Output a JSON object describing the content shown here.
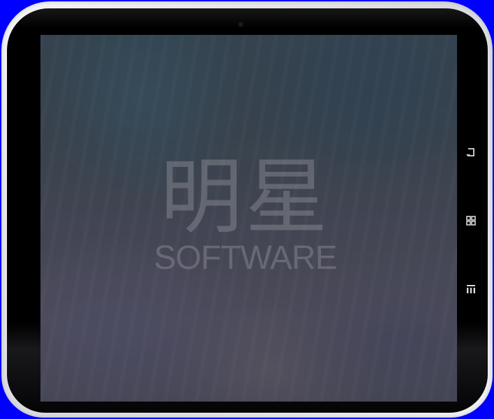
{
  "brand": {
    "cjk": "明星",
    "latin": "SOFTWARE"
  },
  "icons": {
    "back": "back-icon",
    "home": "home-icon",
    "menu": "menu-icon"
  },
  "colors": {
    "background": "#0000ff",
    "bezel": "#000000",
    "frame": "#e6e7ea",
    "watermark": "#96969e"
  }
}
